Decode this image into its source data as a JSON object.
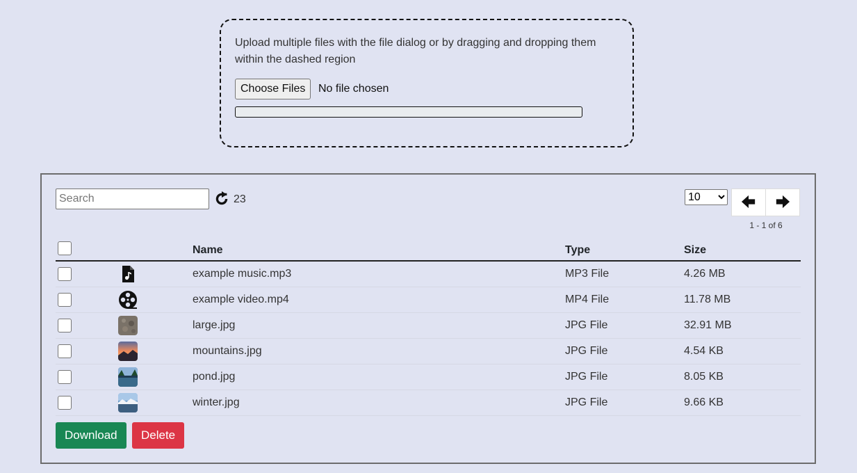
{
  "upload": {
    "instructions": "Upload multiple files with the file dialog or by dragging and dropping them within the dashed region",
    "choose_label": "Choose Files",
    "no_file_text": "No file chosen",
    "progress_fraction": 0
  },
  "toolbar": {
    "search_placeholder": "Search",
    "refresh_icon": "refresh-icon",
    "file_count": "23",
    "page_size": "10",
    "page_size_options": [
      "10"
    ],
    "range_text": "1 - 1 of 6"
  },
  "table": {
    "headers": {
      "name": "Name",
      "type": "Type",
      "size": "Size"
    },
    "rows": [
      {
        "icon": "music-file-icon",
        "name": "example music.mp3",
        "type": "MP3 File",
        "size": "4.26 MB"
      },
      {
        "icon": "film-reel-icon",
        "name": "example video.mp4",
        "type": "MP4 File",
        "size": "11.78 MB"
      },
      {
        "icon": "image-thumbnail",
        "name": "large.jpg",
        "type": "JPG File",
        "size": "32.91 MB"
      },
      {
        "icon": "image-thumbnail",
        "name": "mountains.jpg",
        "type": "JPG File",
        "size": "4.54 KB"
      },
      {
        "icon": "image-thumbnail",
        "name": "pond.jpg",
        "type": "JPG File",
        "size": "8.05 KB"
      },
      {
        "icon": "image-thumbnail",
        "name": "winter.jpg",
        "type": "JPG File",
        "size": "9.66 KB"
      }
    ]
  },
  "actions": {
    "download_label": "Download",
    "delete_label": "Delete",
    "download_color": "#198754",
    "delete_color": "#dc3545"
  }
}
